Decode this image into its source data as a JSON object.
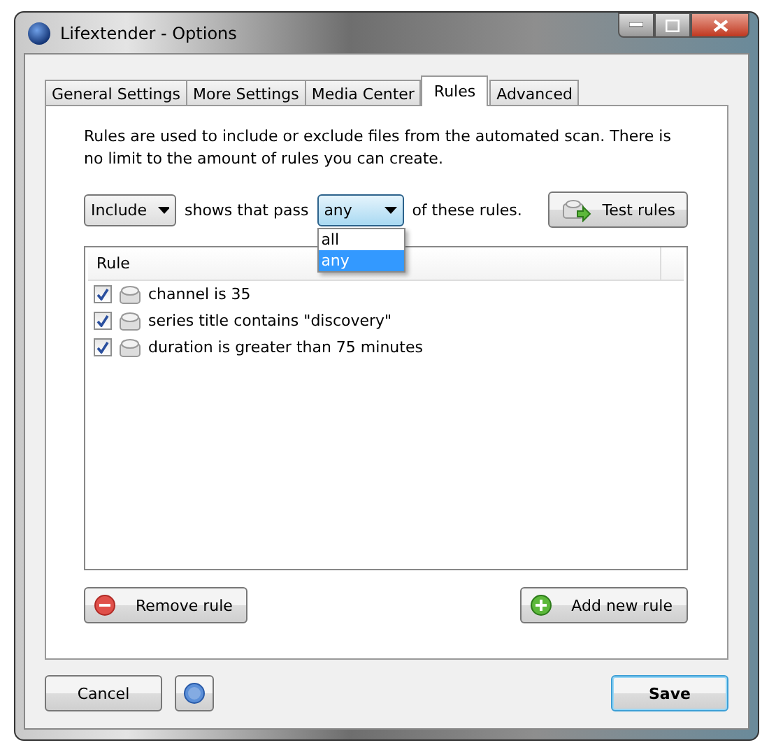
{
  "window": {
    "title": "Lifextender - Options"
  },
  "tabs": [
    {
      "label": "General Settings",
      "selected": false
    },
    {
      "label": "More Settings",
      "selected": false
    },
    {
      "label": "Media Center",
      "selected": false
    },
    {
      "label": "Rules",
      "selected": true
    },
    {
      "label": "Advanced",
      "selected": false
    }
  ],
  "description": "Rules  are  used to include or exclude files from the automated scan.  There is no limit to the amount of rules you can create.",
  "action_select": {
    "value": "Include"
  },
  "middle_text": "shows that pass",
  "match_select": {
    "value": "any",
    "expanded": true,
    "options": [
      {
        "label": "all",
        "selected": false
      },
      {
        "label": "any",
        "selected": true
      }
    ]
  },
  "trailing_text": "of these rules.",
  "test_button": "Test rules",
  "table": {
    "columns": [
      "Rule"
    ],
    "rows": [
      {
        "text": "channel is 35",
        "checked": true
      },
      {
        "text": "series title contains \"discovery\"",
        "checked": true
      },
      {
        "text": "duration is greater than 75 minutes",
        "checked": true
      }
    ]
  },
  "remove_button": "Remove rule",
  "add_button": "Add new rule",
  "footer": {
    "cancel": "Cancel",
    "save": "Save"
  }
}
